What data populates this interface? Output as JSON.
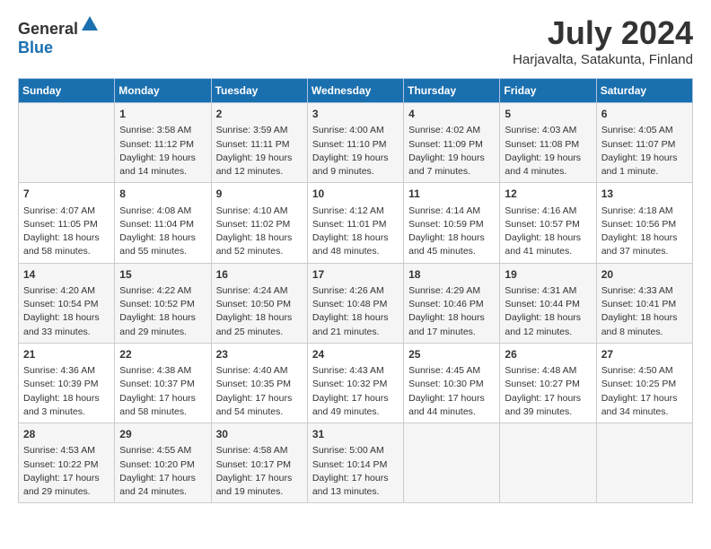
{
  "header": {
    "logo_general": "General",
    "logo_blue": "Blue",
    "title": "July 2024",
    "location": "Harjavalta, Satakunta, Finland"
  },
  "weekdays": [
    "Sunday",
    "Monday",
    "Tuesday",
    "Wednesday",
    "Thursday",
    "Friday",
    "Saturday"
  ],
  "weeks": [
    [
      {
        "day": "",
        "detail": ""
      },
      {
        "day": "1",
        "detail": "Sunrise: 3:58 AM\nSunset: 11:12 PM\nDaylight: 19 hours\nand 14 minutes."
      },
      {
        "day": "2",
        "detail": "Sunrise: 3:59 AM\nSunset: 11:11 PM\nDaylight: 19 hours\nand 12 minutes."
      },
      {
        "day": "3",
        "detail": "Sunrise: 4:00 AM\nSunset: 11:10 PM\nDaylight: 19 hours\nand 9 minutes."
      },
      {
        "day": "4",
        "detail": "Sunrise: 4:02 AM\nSunset: 11:09 PM\nDaylight: 19 hours\nand 7 minutes."
      },
      {
        "day": "5",
        "detail": "Sunrise: 4:03 AM\nSunset: 11:08 PM\nDaylight: 19 hours\nand 4 minutes."
      },
      {
        "day": "6",
        "detail": "Sunrise: 4:05 AM\nSunset: 11:07 PM\nDaylight: 19 hours\nand 1 minute."
      }
    ],
    [
      {
        "day": "7",
        "detail": "Sunrise: 4:07 AM\nSunset: 11:05 PM\nDaylight: 18 hours\nand 58 minutes."
      },
      {
        "day": "8",
        "detail": "Sunrise: 4:08 AM\nSunset: 11:04 PM\nDaylight: 18 hours\nand 55 minutes."
      },
      {
        "day": "9",
        "detail": "Sunrise: 4:10 AM\nSunset: 11:02 PM\nDaylight: 18 hours\nand 52 minutes."
      },
      {
        "day": "10",
        "detail": "Sunrise: 4:12 AM\nSunset: 11:01 PM\nDaylight: 18 hours\nand 48 minutes."
      },
      {
        "day": "11",
        "detail": "Sunrise: 4:14 AM\nSunset: 10:59 PM\nDaylight: 18 hours\nand 45 minutes."
      },
      {
        "day": "12",
        "detail": "Sunrise: 4:16 AM\nSunset: 10:57 PM\nDaylight: 18 hours\nand 41 minutes."
      },
      {
        "day": "13",
        "detail": "Sunrise: 4:18 AM\nSunset: 10:56 PM\nDaylight: 18 hours\nand 37 minutes."
      }
    ],
    [
      {
        "day": "14",
        "detail": "Sunrise: 4:20 AM\nSunset: 10:54 PM\nDaylight: 18 hours\nand 33 minutes."
      },
      {
        "day": "15",
        "detail": "Sunrise: 4:22 AM\nSunset: 10:52 PM\nDaylight: 18 hours\nand 29 minutes."
      },
      {
        "day": "16",
        "detail": "Sunrise: 4:24 AM\nSunset: 10:50 PM\nDaylight: 18 hours\nand 25 minutes."
      },
      {
        "day": "17",
        "detail": "Sunrise: 4:26 AM\nSunset: 10:48 PM\nDaylight: 18 hours\nand 21 minutes."
      },
      {
        "day": "18",
        "detail": "Sunrise: 4:29 AM\nSunset: 10:46 PM\nDaylight: 18 hours\nand 17 minutes."
      },
      {
        "day": "19",
        "detail": "Sunrise: 4:31 AM\nSunset: 10:44 PM\nDaylight: 18 hours\nand 12 minutes."
      },
      {
        "day": "20",
        "detail": "Sunrise: 4:33 AM\nSunset: 10:41 PM\nDaylight: 18 hours\nand 8 minutes."
      }
    ],
    [
      {
        "day": "21",
        "detail": "Sunrise: 4:36 AM\nSunset: 10:39 PM\nDaylight: 18 hours\nand 3 minutes."
      },
      {
        "day": "22",
        "detail": "Sunrise: 4:38 AM\nSunset: 10:37 PM\nDaylight: 17 hours\nand 58 minutes."
      },
      {
        "day": "23",
        "detail": "Sunrise: 4:40 AM\nSunset: 10:35 PM\nDaylight: 17 hours\nand 54 minutes."
      },
      {
        "day": "24",
        "detail": "Sunrise: 4:43 AM\nSunset: 10:32 PM\nDaylight: 17 hours\nand 49 minutes."
      },
      {
        "day": "25",
        "detail": "Sunrise: 4:45 AM\nSunset: 10:30 PM\nDaylight: 17 hours\nand 44 minutes."
      },
      {
        "day": "26",
        "detail": "Sunrise: 4:48 AM\nSunset: 10:27 PM\nDaylight: 17 hours\nand 39 minutes."
      },
      {
        "day": "27",
        "detail": "Sunrise: 4:50 AM\nSunset: 10:25 PM\nDaylight: 17 hours\nand 34 minutes."
      }
    ],
    [
      {
        "day": "28",
        "detail": "Sunrise: 4:53 AM\nSunset: 10:22 PM\nDaylight: 17 hours\nand 29 minutes."
      },
      {
        "day": "29",
        "detail": "Sunrise: 4:55 AM\nSunset: 10:20 PM\nDaylight: 17 hours\nand 24 minutes."
      },
      {
        "day": "30",
        "detail": "Sunrise: 4:58 AM\nSunset: 10:17 PM\nDaylight: 17 hours\nand 19 minutes."
      },
      {
        "day": "31",
        "detail": "Sunrise: 5:00 AM\nSunset: 10:14 PM\nDaylight: 17 hours\nand 13 minutes."
      },
      {
        "day": "",
        "detail": ""
      },
      {
        "day": "",
        "detail": ""
      },
      {
        "day": "",
        "detail": ""
      }
    ]
  ]
}
